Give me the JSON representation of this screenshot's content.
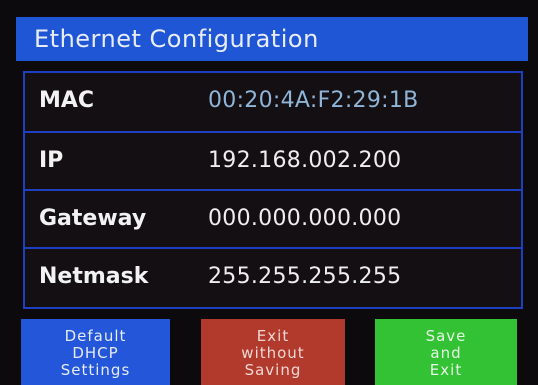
{
  "title": "Ethernet Configuration",
  "rows": [
    {
      "label": "MAC",
      "value": "00:20:4A:F2:29:1B"
    },
    {
      "label": "IP",
      "value": "192.168.002.200"
    },
    {
      "label": "Gateway",
      "value": "000.000.000.000"
    },
    {
      "label": "Netmask",
      "value": "255.255.255.255"
    }
  ],
  "buttons": {
    "default_dhcp": [
      "Default",
      "DHCP",
      "Settings"
    ],
    "exit_without_saving": [
      "Exit",
      "without",
      "Saving"
    ],
    "save_and_exit": [
      "Save",
      "and",
      "Exit"
    ]
  },
  "colors": {
    "title_bg": "#1f56d6",
    "border": "#1e3fc0",
    "btn_blue": "#2356d8",
    "btn_red": "#b23a2c",
    "btn_green": "#33c233"
  }
}
